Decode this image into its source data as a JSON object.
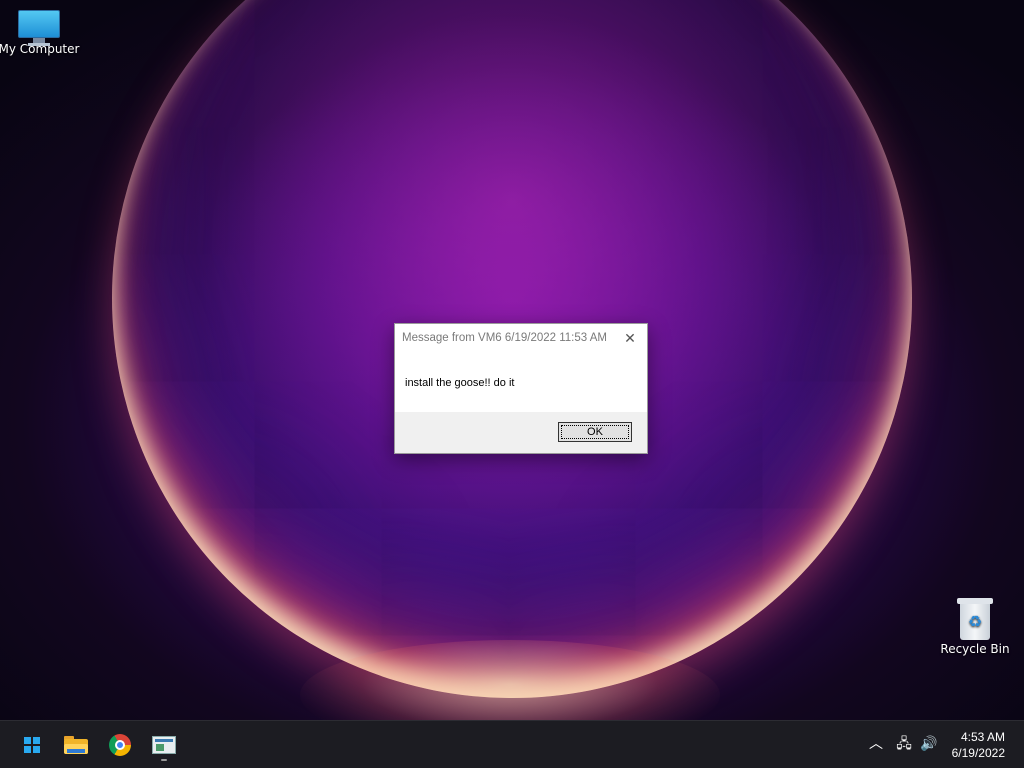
{
  "desktop": {
    "icons": [
      {
        "label": "My Computer"
      },
      {
        "label": "Recycle Bin"
      }
    ]
  },
  "dialog": {
    "title": "Message from VM6 6/19/2022 11:53 AM",
    "message": "install the goose!! do it",
    "ok_label": "OK",
    "close_glyph": "✕"
  },
  "taskbar": {
    "apps": [
      {
        "name": "start-icon"
      },
      {
        "name": "file-explorer-icon"
      },
      {
        "name": "chrome-icon"
      },
      {
        "name": "message-app-icon",
        "running": true
      }
    ],
    "tray": {
      "chevron": "︿",
      "network": "🖧",
      "volume": "🔊"
    },
    "clock": {
      "time": "4:53 AM",
      "date": "6/19/2022"
    }
  },
  "colors": {
    "accent": "#29a9f0",
    "taskbar_bg": "#1c1c22",
    "dialog_footer": "#f0f0f0"
  }
}
